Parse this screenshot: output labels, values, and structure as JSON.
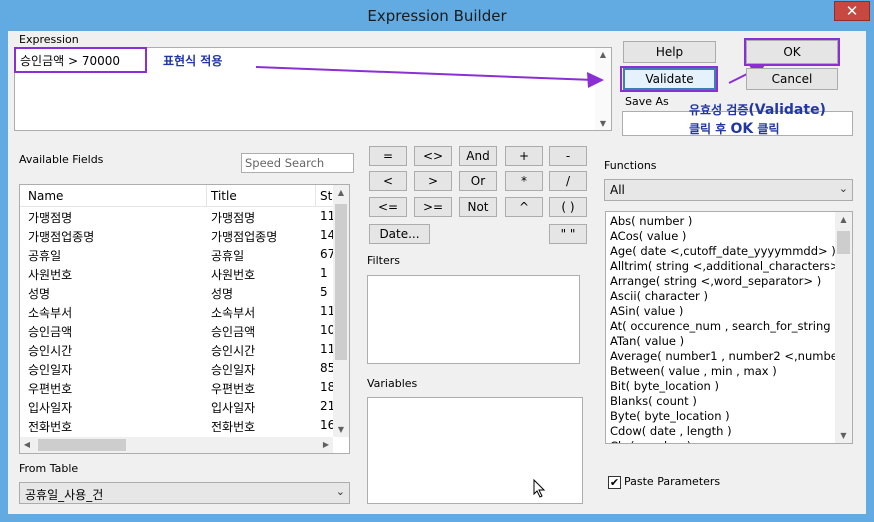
{
  "window": {
    "title": "Expression Builder",
    "close_glyph": "✕"
  },
  "expression": {
    "label": "Expression",
    "value": "승인금액 > 70000",
    "annotation": "표현식 적용"
  },
  "buttons": {
    "help": "Help",
    "ok": "OK",
    "validate": "Validate",
    "cancel": "Cancel"
  },
  "save_as": {
    "label": "Save As",
    "value": ""
  },
  "validate_annotation": {
    "line1_prefix": "유효성 검증",
    "line1_strong": "(Validate)",
    "line2_prefix": "클릭 후 ",
    "line2_strong": "OK",
    "line2_suffix": " 클릭"
  },
  "available_fields": {
    "label": "Available Fields",
    "search_placeholder": "Speed Search",
    "columns": [
      "Name",
      "Title",
      "St"
    ],
    "rows": [
      [
        "가맹점명",
        "가맹점명",
        "11"
      ],
      [
        "가맹점업종명",
        "가맹점업종명",
        "14"
      ],
      [
        "공휴일",
        "공휴일",
        "67"
      ],
      [
        "사원번호",
        "사원번호",
        "1"
      ],
      [
        "성명",
        "성명",
        "5"
      ],
      [
        "소속부서",
        "소속부서",
        "11"
      ],
      [
        "승인금액",
        "승인금액",
        "10"
      ],
      [
        "승인시간",
        "승인시간",
        "11"
      ],
      [
        "승인일자",
        "승인일자",
        "85"
      ],
      [
        "우편번호",
        "우편번호",
        "18"
      ],
      [
        "입사일자",
        "입사일자",
        "21"
      ],
      [
        "전화번호",
        "전화번호",
        "16"
      ]
    ]
  },
  "from_table": {
    "label": "From Table",
    "value": "공휴일_사용_건"
  },
  "operators": {
    "row1": [
      "=",
      "<>",
      "And",
      "+",
      "-"
    ],
    "row2": [
      "<",
      ">",
      "Or",
      "*",
      "/"
    ],
    "row3": [
      "<=",
      ">=",
      "Not",
      "^",
      "( )"
    ],
    "date": "Date...",
    "quote": "\" \""
  },
  "filters": {
    "label": "Filters"
  },
  "variables": {
    "label": "Variables"
  },
  "functions": {
    "label": "Functions",
    "category": "All",
    "items": [
      "Abs( number )",
      "ACos( value )",
      "Age( date <,cutoff_date_yyyymmdd> )",
      "Alltrim( string <,additional_characters> )",
      "Arrange( string <,word_separator> )",
      "Ascii( character )",
      "ASin( value )",
      "At( occurence_num , search_for_string , with",
      "ATan( value )",
      "Average( number1 , number2 <,number3 ..",
      "Between( value , min , max )",
      "Bit( byte_location )",
      "Blanks( count )",
      "Byte( byte_location )",
      "Cdow( date , length )",
      "Chr( number )"
    ]
  },
  "paste_parameters": {
    "label": "Paste Parameters",
    "checked": true
  },
  "colors": {
    "accent": "#8b2fd4",
    "annotation_text": "#2137a6",
    "title_bar": "#62abe2",
    "close": "#c7483f"
  }
}
